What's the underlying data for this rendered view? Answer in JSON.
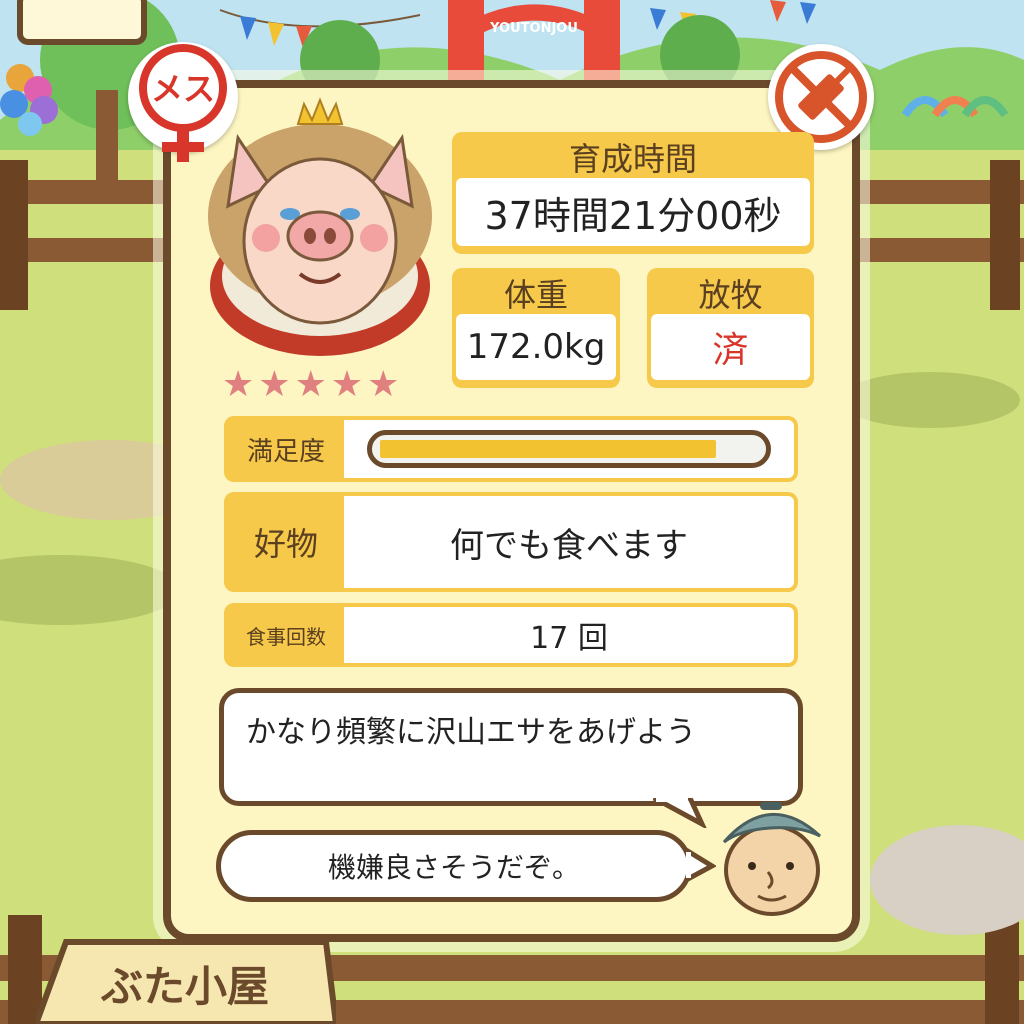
{
  "gender_badge": {
    "text": "メス"
  },
  "vaccine_badge": {
    "icon": "syringe-crossed-icon"
  },
  "pig": {
    "rating_stars": 5,
    "star_glyph": "★"
  },
  "stats": {
    "growth_time": {
      "label": "育成時間",
      "value": "37時間21分00秒"
    },
    "weight": {
      "label": "体重",
      "value": "172.0kg"
    },
    "grazing": {
      "label": "放牧",
      "value": "済"
    }
  },
  "satisfaction": {
    "label": "満足度",
    "level": 0.89
  },
  "favorite": {
    "label": "好物",
    "value": "何でも食べます"
  },
  "meals": {
    "label": "食事回数",
    "value": "17 回"
  },
  "advice": {
    "text": "かなり頻繁に沢山エサをあげよう"
  },
  "mood": {
    "text": "機嫌良さそうだぞ。"
  },
  "signboard": {
    "text": "ぶた小屋"
  },
  "banner": {
    "text": "YOUTONJOU"
  },
  "colors": {
    "frame": "#6b4a2c",
    "label_bg": "#f6c94a",
    "card_bg": "#fdf6c2",
    "accent_red": "#d8362a",
    "star": "#e08080"
  }
}
